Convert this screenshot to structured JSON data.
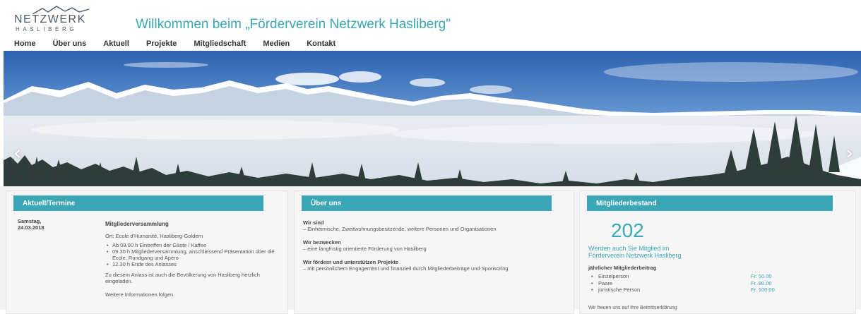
{
  "header": {
    "logo_top": "NETZWERK",
    "logo_bottom": "HASLIBERG",
    "welcome": "Willkommen beim „Förderverein Netzwerk Hasliberg\""
  },
  "nav": [
    {
      "label": "Home",
      "name": "nav-home"
    },
    {
      "label": "Über uns",
      "name": "nav-ueber-uns"
    },
    {
      "label": "Aktuell",
      "name": "nav-aktuell"
    },
    {
      "label": "Projekte",
      "name": "nav-projekte"
    },
    {
      "label": "Mitgliedschaft",
      "name": "nav-mitgliedschaft"
    },
    {
      "label": "Medien",
      "name": "nav-medien"
    },
    {
      "label": "Kontakt",
      "name": "nav-kontakt"
    }
  ],
  "slider": {
    "prev": "‹",
    "next": "›"
  },
  "panels": {
    "aktuell": {
      "title": "Aktuell/Termine",
      "date_line1": "Samstag,",
      "date_line2": "24.03.2018",
      "event_title": "Mitgliederversammlung",
      "location": "Ort: Ecole d'Humanité, Hasliberg-Goldern",
      "items": [
        "Ab 09.00 h Eintreffen der Gäste / Kaffee",
        "09.30 h Mitgliederversammlung, anschliessend Präsentation über die Ecole, Rundgang und Apéro",
        "12.30 h Ende des Anlasses"
      ],
      "note": "Zu diesem Anlass ist auch die Bevölkerung von Hasliberg herzlich eingeladen.",
      "more": "Weitere Informationen folgen."
    },
    "ueber": {
      "title": "Über uns",
      "blocks": [
        {
          "head": "Wir sind",
          "text": "– Einheimische, Zweitwohnungsbesitzende, weitere Personen und Organisationen"
        },
        {
          "head": "Wir bezwecken",
          "text": "– eine langfristig orientierte Förderung von Hasliberg"
        },
        {
          "head": "Wir fördern und unterstützen Projekte",
          "text": "– mit persönlichem Engagement und finanziell durch Mitgliederbeiträge und Sponsoring"
        }
      ]
    },
    "mitglieder": {
      "title": "Mitgliederbestand",
      "count": "202",
      "join_line1": "Werden auch Sie Mitglied im",
      "join_line2": "Förderverein Netzwerk Hasliberg",
      "fee_title": "jährlicher Mitgliederbeitrag",
      "fees": [
        {
          "name": "Einzelperson",
          "price": "Fr.  50.00"
        },
        {
          "name": "Paare",
          "price": "Fr.  80.00"
        },
        {
          "name": "juristische Person",
          "price": "Fr. 100.00"
        }
      ],
      "footnote": "Wir freuen uns auf Ihre Beitrittserklärung"
    }
  },
  "colors": {
    "accent": "#3aa6b6",
    "sky_top": "#2f66b3",
    "sky_bottom": "#b8d2ee"
  }
}
